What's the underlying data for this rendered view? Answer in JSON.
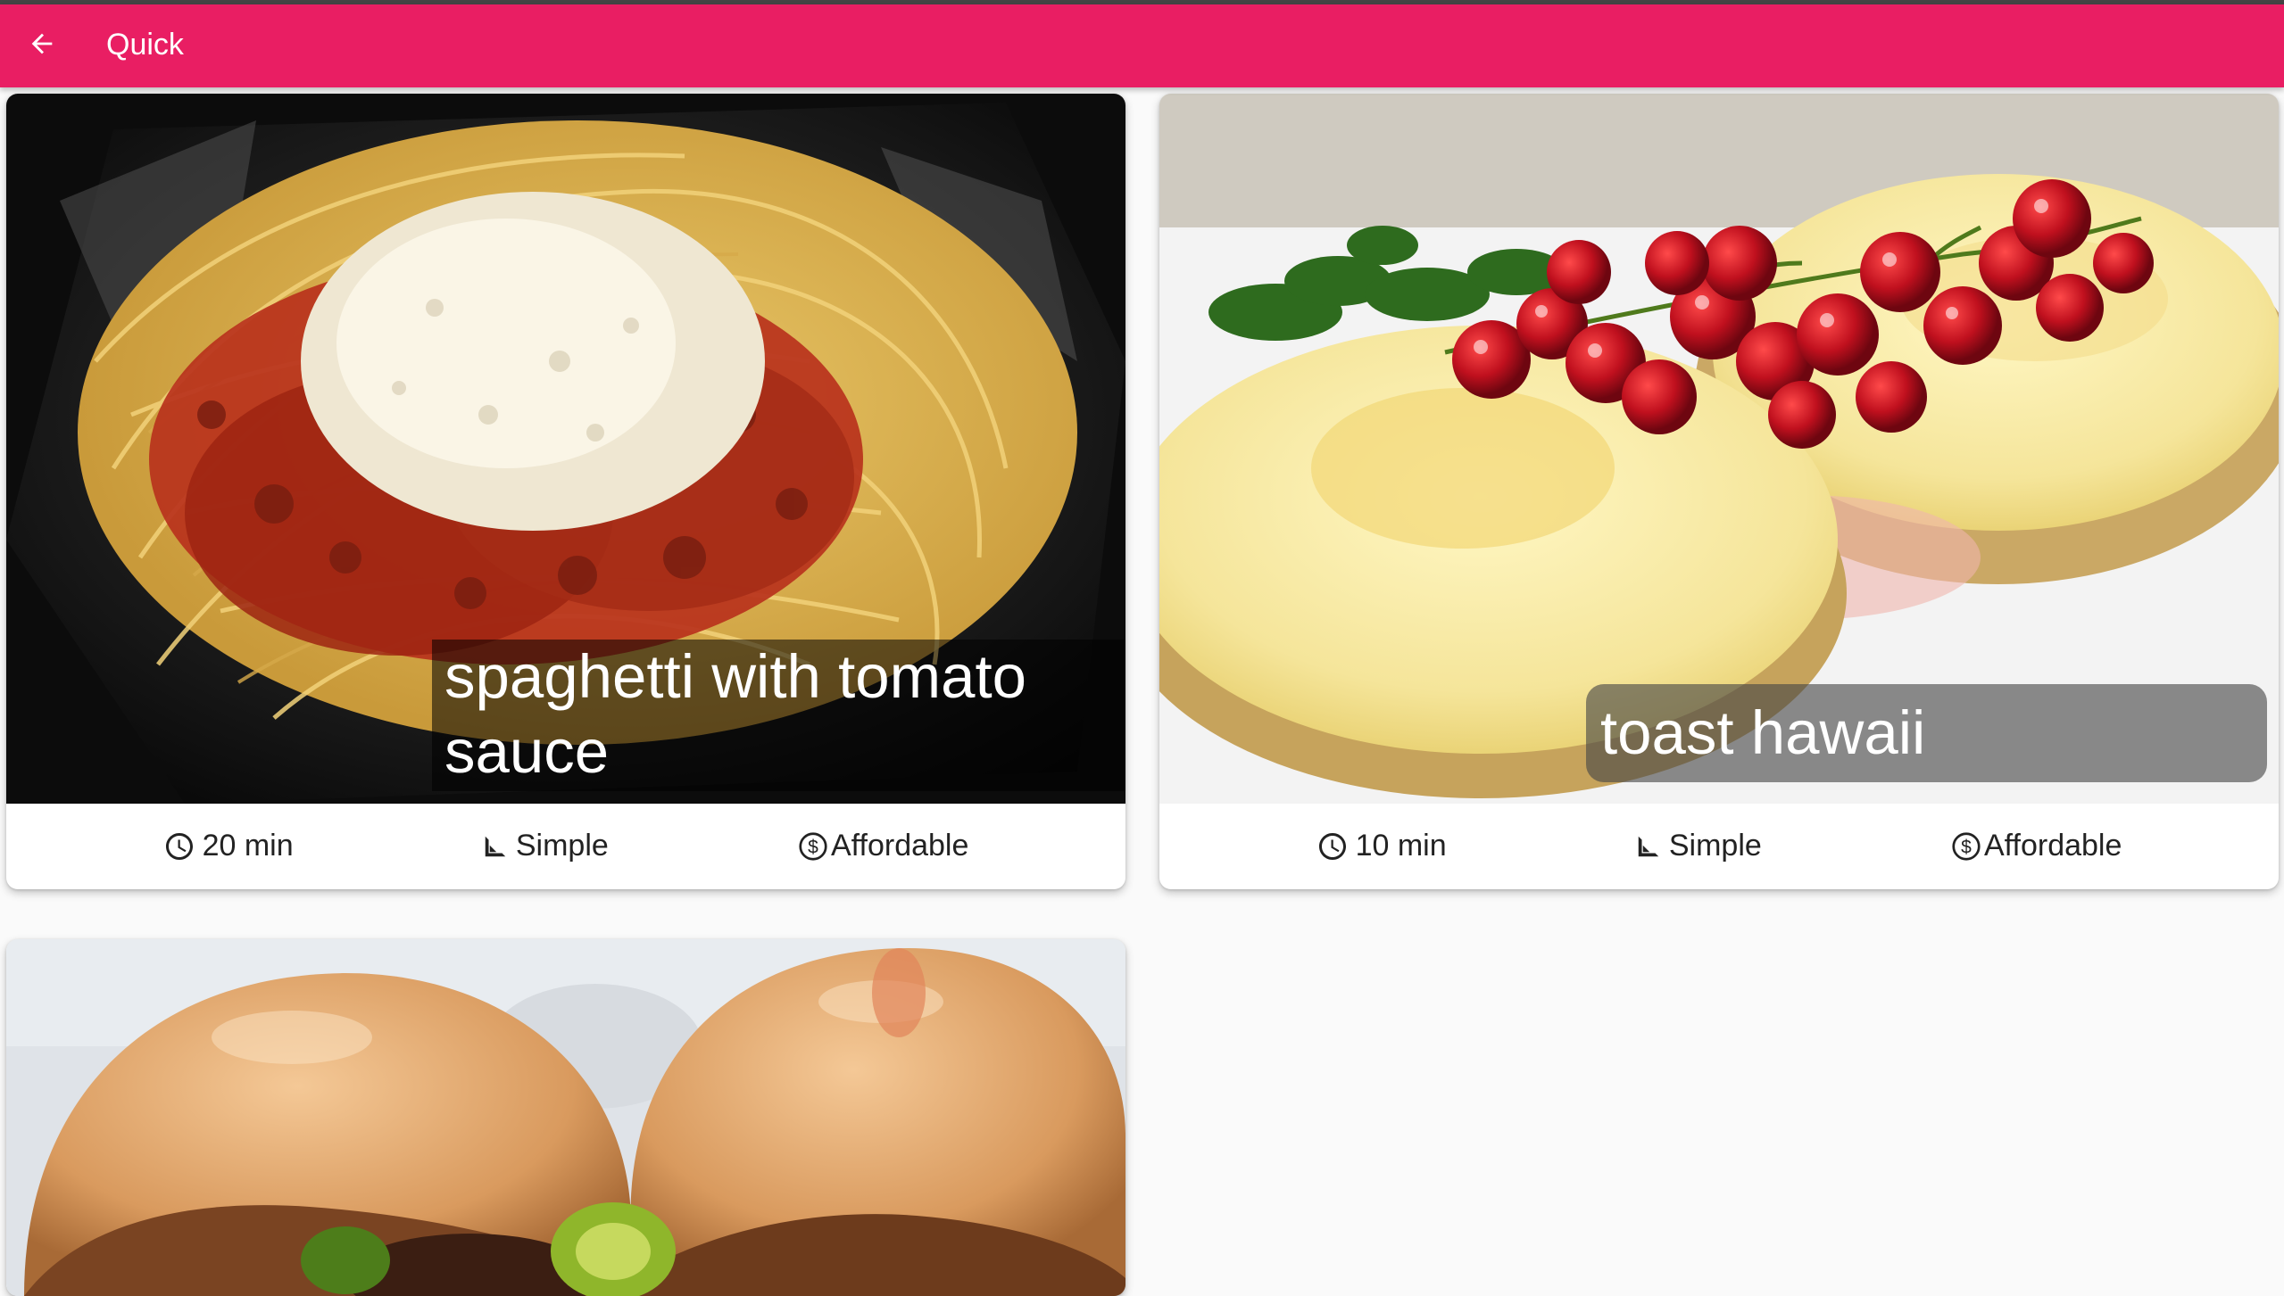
{
  "appbar": {
    "title": "Quick",
    "back_icon": "arrow-back-icon",
    "color": "#e91e63"
  },
  "meals": [
    {
      "title": "spaghetti with tomato sauce",
      "title_lines": [
        "spaghetti with tomato",
        "sauce"
      ],
      "duration": "20 min",
      "complexity": "Simple",
      "affordability": "Affordable",
      "image": "spaghetti-photo"
    },
    {
      "title": "toast hawaii",
      "title_lines": [
        "toast hawaii"
      ],
      "duration": "10 min",
      "complexity": "Simple",
      "affordability": "Affordable",
      "image": "toast-hawaii-photo"
    },
    {
      "image": "burger-photo"
    }
  ],
  "icons": {
    "duration": "clock-icon",
    "complexity": "work-ruler-icon",
    "affordability": "dollar-circle-icon"
  }
}
